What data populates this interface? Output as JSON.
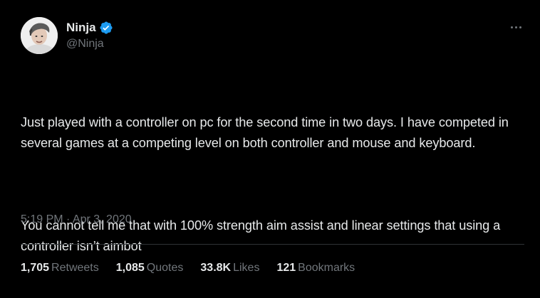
{
  "author": {
    "display_name": "Ninja",
    "handle": "@Ninja",
    "verified": true,
    "avatar_icon": "avatar-photo"
  },
  "menu": {
    "icon": "more-horizontal-icon"
  },
  "tweet": {
    "paragraphs": [
      "Just played with a controller on pc for the second time in two days. I have competed in several games at a competing level on both controller and mouse and keyboard.",
      "You cannot tell me that with 100% strength aim assist and linear settings that using a controller isn’t aimbot"
    ],
    "timestamp": "5:19 PM · Apr 3, 2020"
  },
  "stats": [
    {
      "value": "1,705",
      "label": "Retweets"
    },
    {
      "value": "1,085",
      "label": "Quotes"
    },
    {
      "value": "33.8K",
      "label": "Likes"
    },
    {
      "value": "121",
      "label": "Bookmarks"
    }
  ],
  "colors": {
    "background": "#000000",
    "primary_text": "#e7e9ea",
    "secondary_text": "#71767b",
    "verified_badge": "#1d9bf0",
    "divider": "#2f3336"
  }
}
